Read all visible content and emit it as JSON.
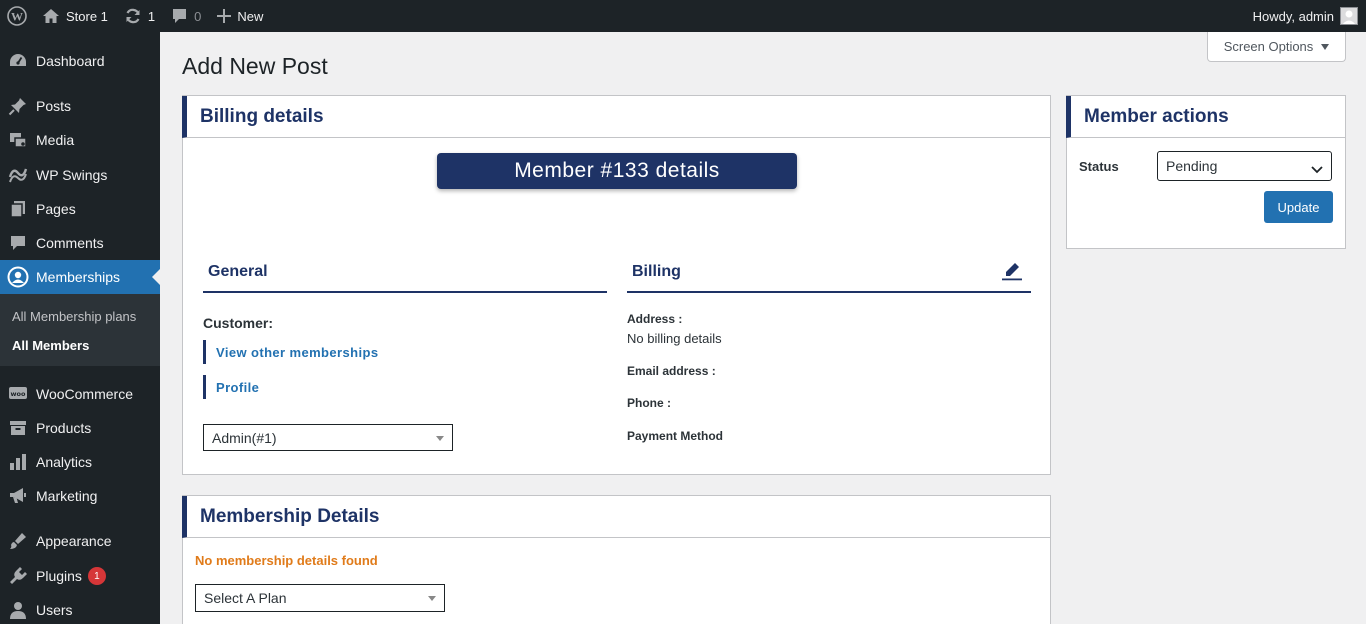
{
  "adminbar": {
    "site_name": "Store 1",
    "updates_count": "1",
    "comments_count": "0",
    "new_label": "New",
    "greeting": "Howdy, admin"
  },
  "sidebar": {
    "items": [
      {
        "label": "Dashboard",
        "icon": "dashboard-icon"
      },
      {
        "label": "Posts",
        "icon": "pin-icon"
      },
      {
        "label": "Media",
        "icon": "media-icon"
      },
      {
        "label": "WP Swings",
        "icon": "wpswings-icon"
      },
      {
        "label": "Pages",
        "icon": "pages-icon"
      },
      {
        "label": "Comments",
        "icon": "comment-icon"
      },
      {
        "label": "Memberships",
        "icon": "memberships-icon"
      },
      {
        "label": "WooCommerce",
        "icon": "woo-icon"
      },
      {
        "label": "Products",
        "icon": "archive-icon"
      },
      {
        "label": "Analytics",
        "icon": "chart-icon"
      },
      {
        "label": "Marketing",
        "icon": "megaphone-icon"
      },
      {
        "label": "Appearance",
        "icon": "brush-icon"
      },
      {
        "label": "Plugins",
        "icon": "plugin-icon",
        "badge": "1"
      },
      {
        "label": "Users",
        "icon": "users-icon"
      }
    ],
    "submenu": [
      "All Membership plans",
      "All Members"
    ]
  },
  "screen_options": "Screen Options",
  "page_title": "Add New Post",
  "billing_box": {
    "title": "Billing details",
    "member_badge": "Member #133 details",
    "general": {
      "heading": "General",
      "customer_label": "Customer:",
      "links": [
        "View other memberships",
        "Profile"
      ],
      "customer_select": "Admin(#1)"
    },
    "billing": {
      "heading": "Billing",
      "address_label": "Address :",
      "address_value": "No billing details",
      "email_label": "Email address :",
      "phone_label": "Phone :",
      "payment_label": "Payment Method"
    }
  },
  "membership_box": {
    "title": "Membership Details",
    "empty_message": "No membership details found",
    "plan_select": "Select A Plan"
  },
  "member_actions": {
    "title": "Member actions",
    "status_label": "Status",
    "status_value": "Pending",
    "update_label": "Update"
  },
  "colors": {
    "accent": "#2271b1",
    "heading": "#1e3366",
    "warning": "#e07b1a",
    "adminbar": "#1d2327"
  }
}
